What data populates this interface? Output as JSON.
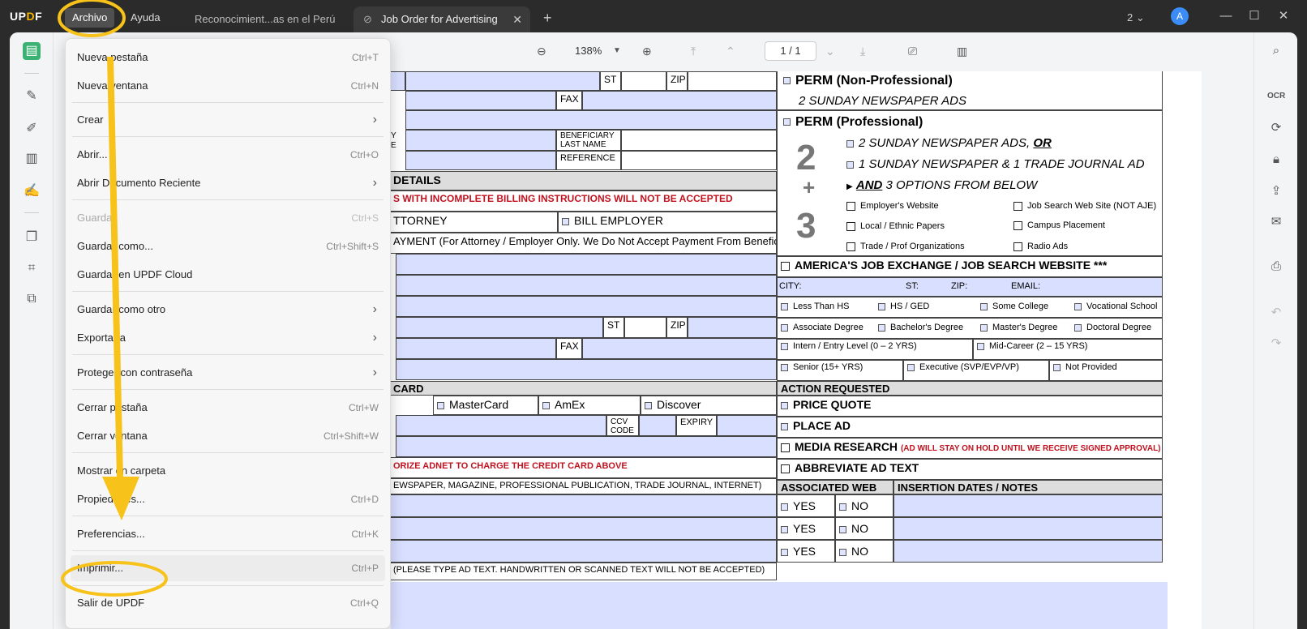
{
  "app": {
    "logo": "UPDF"
  },
  "menubar": {
    "archivo": "Archivo",
    "ayuda": "Ayuda"
  },
  "tabs": [
    {
      "label": "Reconocimient...as en el Perú"
    },
    {
      "label": "Job Order for Advertising"
    }
  ],
  "titlebar": {
    "count": "2",
    "avatar": "A"
  },
  "toolbar": {
    "zoom": "138%",
    "page": "1  /  1"
  },
  "menu": {
    "items": [
      {
        "label": "Nueva pestaña",
        "shortcut": "Ctrl+T"
      },
      {
        "label": "Nueva ventana",
        "shortcut": "Ctrl+N"
      },
      {
        "label": "Crear",
        "shortcut": ""
      },
      {
        "label": "Abrir...",
        "shortcut": "Ctrl+O"
      },
      {
        "label": "Abrir Documento Reciente",
        "shortcut": ""
      },
      {
        "label": "Guardar",
        "shortcut": "Ctrl+S"
      },
      {
        "label": "Guardar como...",
        "shortcut": "Ctrl+Shift+S"
      },
      {
        "label": "Guardar en UPDF Cloud",
        "shortcut": ""
      },
      {
        "label": "Guardar como otro",
        "shortcut": ""
      },
      {
        "label": "Exportar a",
        "shortcut": ""
      },
      {
        "label": "Proteger con contraseña",
        "shortcut": ""
      },
      {
        "label": "Cerrar pestaña",
        "shortcut": "Ctrl+W"
      },
      {
        "label": "Cerrar ventana",
        "shortcut": "Ctrl+Shift+W"
      },
      {
        "label": "Mostrar en carpeta",
        "shortcut": ""
      },
      {
        "label": "Propiedades...",
        "shortcut": "Ctrl+D"
      },
      {
        "label": "Preferencias...",
        "shortcut": "Ctrl+K"
      },
      {
        "label": "Imprimir...",
        "shortcut": "Ctrl+P"
      },
      {
        "label": "Salir de UPDF",
        "shortcut": "Ctrl+Q"
      }
    ]
  },
  "doc": {
    "st": "ST",
    "zip": "ZIP",
    "fax": "FAX",
    "beneficiary_last": "BENEFICIARY",
    "last_name": "LAST NAME",
    "reference": "REFERENCE",
    "billing_frag_y": "Y",
    "billing_frag_e": "E",
    "details": "DETAILS",
    "incomplete": "S WITH INCOMPLETE BILLING INSTRUCTIONS WILL NOT BE ACCEPTED",
    "attorney": "TTORNEY",
    "bill_employer": "BILL EMPLOYER",
    "payment": "AYMENT (For Attorney / Employer Only. We Do Not Accept Payment From Beneficiary)",
    "card": "CARD",
    "mastercard": "MasterCard",
    "amex": "AmEx",
    "discover": "Discover",
    "ccv": "CCV",
    "code": "CODE",
    "expiry": "EXPIRY",
    "authorize": "ORIZE ADNET TO CHARGE THE CREDIT CARD ABOVE",
    "publication": "EWSPAPER, MAGAZINE, PROFESSIONAL PUBLICATION, TRADE JOURNAL, INTERNET)",
    "adtext": "(PLEASE TYPE AD TEXT. HANDWRITTEN OR SCANNED TEXT WILL NOT BE ACCEPTED)",
    "perm_np": "PERM (Non-Professional)",
    "perm_np_sub": "2 SUNDAY NEWSPAPER ADS",
    "perm_p": "PERM (Professional)",
    "opt1": "2 SUNDAY NEWSPAPER ADS,",
    "or": "OR",
    "opt2": "1 SUNDAY NEWSPAPER & 1 TRADE JOURNAL AD",
    "and": "AND",
    "opt3": "3 OPTIONS FROM BELOW",
    "num2": "2",
    "plus": "+",
    "num3": "3",
    "employers_website": "Employer's Website",
    "job_search_site": "Job Search Web Site (NOT AJE)",
    "local_ethnic": "Local / Ethnic Papers",
    "campus": "Campus Placement",
    "trade_prof": "Trade / Prof Organizations",
    "radio": "Radio Ads",
    "aje": "AMERICA'S JOB EXCHANGE / JOB SEARCH WEBSITE ***",
    "city": "CITY:",
    "st2": "ST:",
    "zip2": "ZIP:",
    "email": "EMAIL:",
    "less_hs": "Less Than HS",
    "hs_ged": "HS / GED",
    "some_college": "Some College",
    "vocational": "Vocational School",
    "associate": "Associate Degree",
    "bachelor": "Bachelor's Degree",
    "master": "Master's Degree",
    "doctoral": "Doctoral Degree",
    "intern": "Intern / Entry Level (0 – 2 YRS)",
    "midcareer": "Mid-Career (2 – 15 YRS)",
    "senior": "Senior (15+ YRS)",
    "executive": "Executive (SVP/EVP/VP)",
    "not_provided": "Not Provided",
    "action_requested": "ACTION REQUESTED",
    "price_quote": "PRICE QUOTE",
    "place_ad": "PLACE AD",
    "media_research": "MEDIA RESEARCH",
    "media_note": "(AD WILL STAY ON HOLD UNTIL WE RECEIVE SIGNED APPROVAL)",
    "abbreviate": "ABBREVIATE AD TEXT",
    "assoc_web": "ASSOCIATED WEB",
    "insertion": "INSERTION DATES / NOTES",
    "yes": "YES",
    "no": "NO"
  }
}
